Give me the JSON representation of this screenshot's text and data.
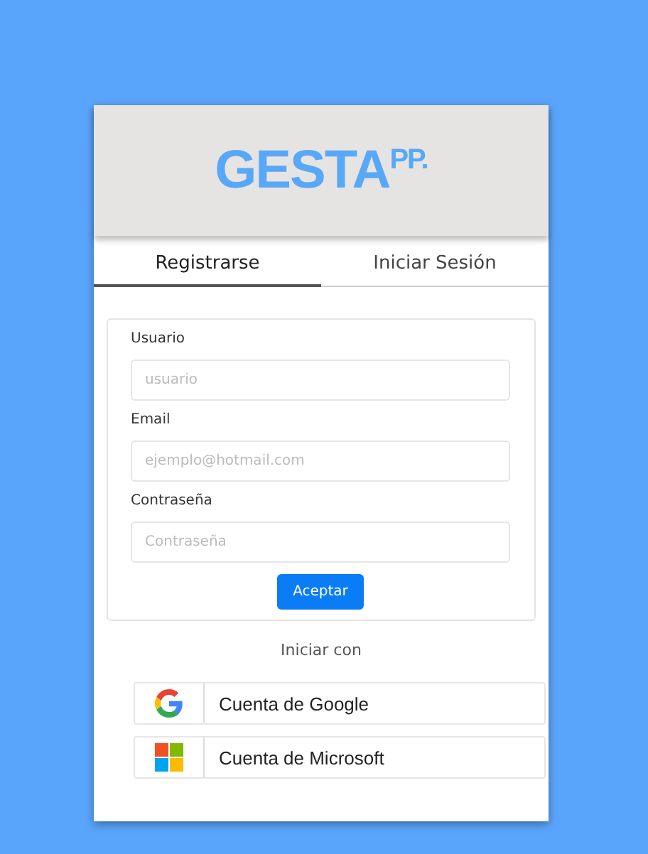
{
  "logo": "GESTA$^{PP.}$",
  "tabs": [
    {
      "label": "Registrarse",
      "selected": true
    },
    {
      "label": "Iniciar Sesión",
      "selected": false
    }
  ],
  "form": {
    "fields": [
      {
        "label": "Usuario",
        "placeholder": "usuario"
      },
      {
        "label": "Email",
        "placeholder": "ejemplo@hotmail.com"
      },
      {
        "label": "Contraseña",
        "placeholder": "Contraseña"
      }
    ],
    "submit": "Aceptar"
  },
  "alt_login": {
    "title": "Iniciar con",
    "providers": [
      {
        "kind": "google",
        "label": "Cuenta de Google"
      },
      {
        "kind": "microsoft",
        "label": "Cuenta de Microsoft"
      }
    ]
  }
}
